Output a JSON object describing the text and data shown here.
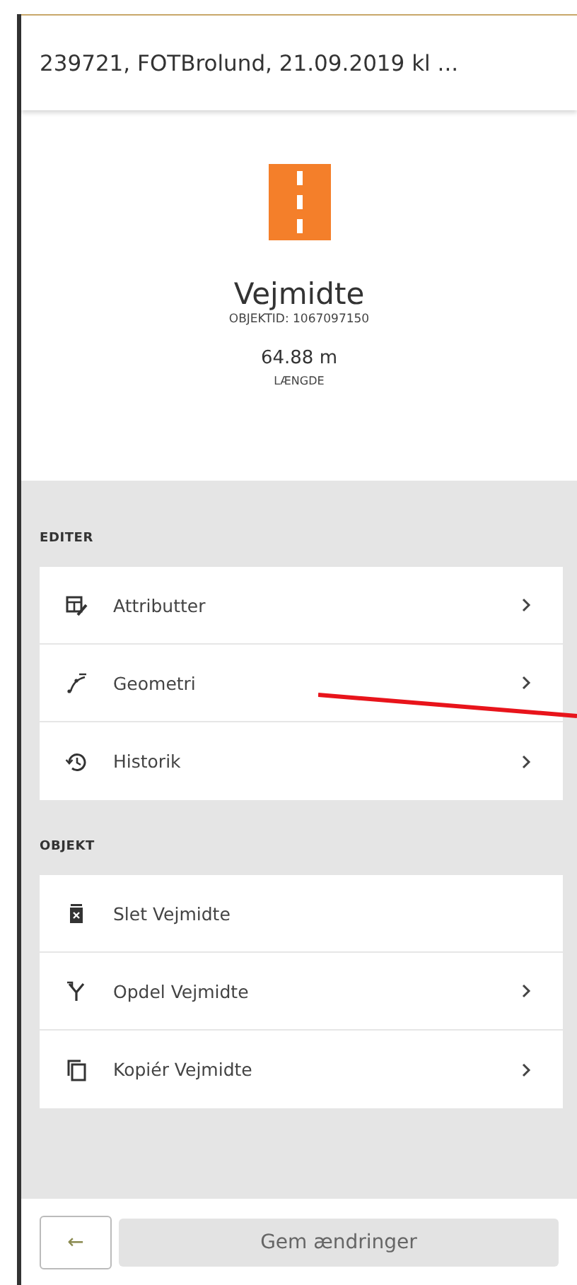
{
  "header": {
    "title": "239721, FOTBrolund, 21.09.2019 kl ..."
  },
  "object": {
    "name": "Vejmidte",
    "id_label": "OBJEKTID: 1067097150",
    "length": "64.88 m",
    "length_label": "LÆNGDE"
  },
  "sections": [
    {
      "title": "EDITER",
      "items": [
        {
          "kind": "attributes",
          "label": "Attributter",
          "chevron": true
        },
        {
          "kind": "geometry",
          "label": "Geometri",
          "chevron": true
        },
        {
          "kind": "history",
          "label": "Historik",
          "chevron": true
        }
      ]
    },
    {
      "title": "OBJEKT",
      "items": [
        {
          "kind": "delete",
          "label": "Slet Vejmidte",
          "chevron": false
        },
        {
          "kind": "split",
          "label": "Opdel Vejmidte",
          "chevron": true
        },
        {
          "kind": "copy",
          "label": "Kopiér Vejmidte",
          "chevron": true
        }
      ]
    }
  ],
  "footer": {
    "back": "←",
    "save": {
      "label": "Gem ændringer",
      "disabled": true
    }
  }
}
